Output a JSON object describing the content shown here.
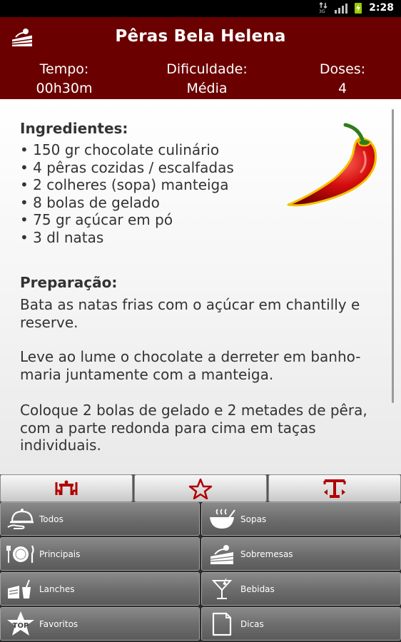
{
  "status_bar": {
    "time": "2:28",
    "icons": [
      "data-3g-icon",
      "signal-icon",
      "battery-charging-icon"
    ]
  },
  "header": {
    "title": "Pêras Bela Helena",
    "app_icon": "cake-slice-icon",
    "tempo_label": "Tempo:",
    "tempo_value": "00h30m",
    "dificuldade_label": "Dificuldade:",
    "dificuldade_value": "Média",
    "doses_label": "Doses:",
    "doses_value": "4"
  },
  "recipe": {
    "difficulty_icon": "chili-pepper-icon",
    "ingredients_title": "Ingredientes:",
    "ingredients": [
      "150 gr chocolate culinário",
      "4 pêras cozidas / escalfadas",
      "2 colheres (sopa) manteiga",
      "8 bolas de gelado",
      "75 gr açúcar em pó",
      "3 dl natas"
    ],
    "preparation_title": "Preparação:",
    "preparation": [
      "Bata as natas frias com o açúcar em chantilly e reserve.",
      "Leve ao lume o chocolate a derreter em banho-maria juntamente com a manteiga.",
      "Coloque 2 bolas de gelado e 2 metades de pêra, com a parte redonda para cima em taças individuais."
    ]
  },
  "tabs": [
    {
      "icon": "dining-table-icon"
    },
    {
      "icon": "star-icon"
    },
    {
      "icon": "font-size-icon"
    }
  ],
  "categories": [
    {
      "label": "Todos",
      "icon": "cloche-icon"
    },
    {
      "label": "Sopas",
      "icon": "soup-bowl-icon"
    },
    {
      "label": "Principais",
      "icon": "plate-cutlery-icon"
    },
    {
      "label": "Sobremesas",
      "icon": "cake-icon"
    },
    {
      "label": "Lanches",
      "icon": "snack-icon"
    },
    {
      "label": "Bebidas",
      "icon": "cocktail-icon"
    },
    {
      "label": "Favoritos",
      "icon": "top-star-icon"
    },
    {
      "label": "Dicas",
      "icon": "notes-icon"
    }
  ],
  "colors": {
    "header_bg": "#6b0000",
    "accent_red": "#b00000",
    "text": "#333333"
  }
}
